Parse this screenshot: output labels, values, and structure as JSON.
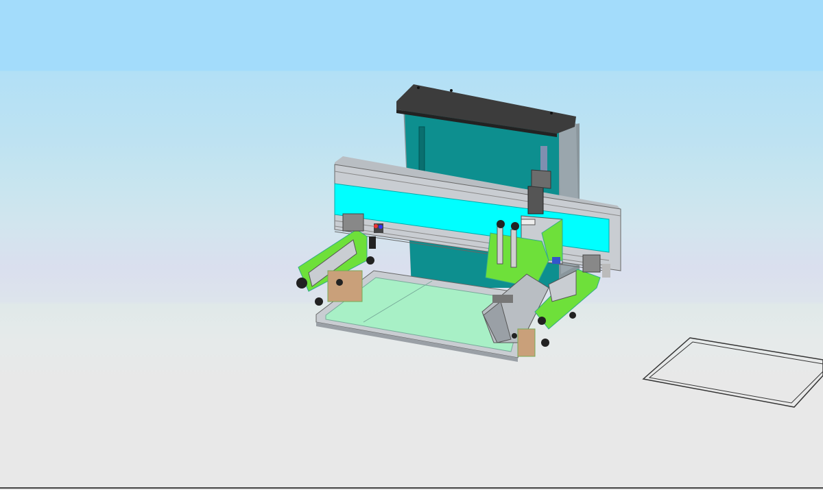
{
  "scene": {
    "type": "3d-cad-viewport",
    "subject": "screen-printing-machine-assembly",
    "colors": {
      "sky_top": "#a3dcfb",
      "floor": "#e8e8e8",
      "housing_teal": "#0d8f8f",
      "housing_top": "#3c3c3c",
      "beam_cyan": "#00ffff",
      "rail_gray": "#c9cdd2",
      "part_green": "#6ee03a",
      "table_green": "#a8f0c6",
      "copper": "#c9a07a"
    }
  }
}
